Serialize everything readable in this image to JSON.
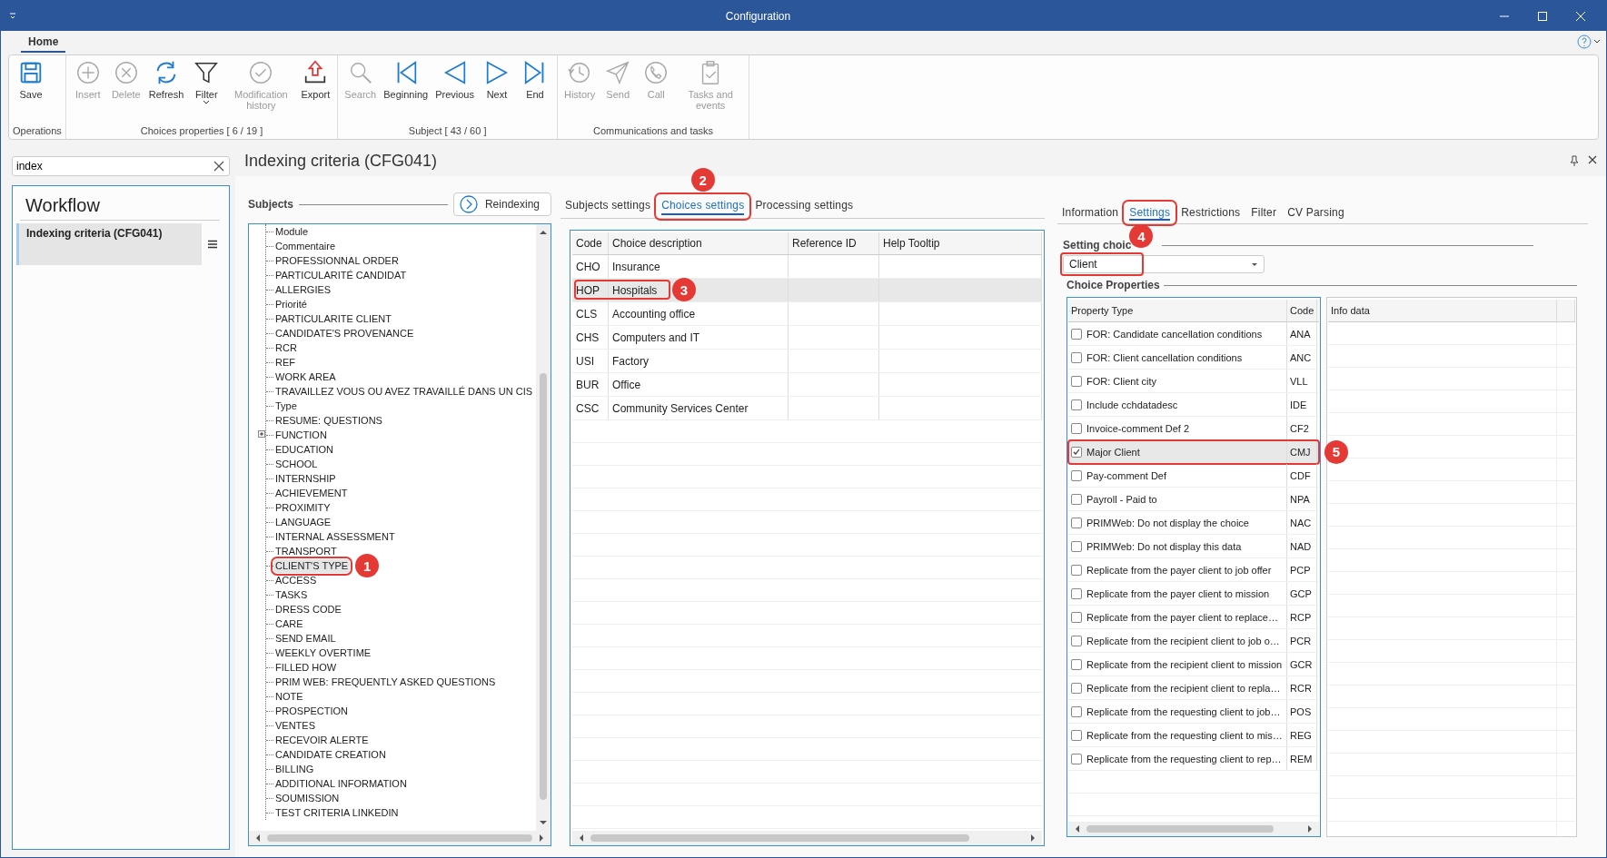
{
  "window": {
    "title": "Configuration"
  },
  "ribbon": {
    "tabs": [
      {
        "label": "Home",
        "selected": true
      }
    ],
    "groups": [
      {
        "label": "Operations",
        "buttons": [
          {
            "label": "Save",
            "disabled": false
          }
        ]
      },
      {
        "label": "Choices properties [ 6 / 19 ]",
        "buttons": [
          {
            "label": "Insert",
            "disabled": true
          },
          {
            "label": "Delete",
            "disabled": true
          },
          {
            "label": "Refresh",
            "disabled": false
          },
          {
            "label": "Filter",
            "disabled": false,
            "dropdown": true
          },
          {
            "label": "Modification history",
            "disabled": true
          },
          {
            "label": "Export",
            "disabled": false
          }
        ]
      },
      {
        "label": "Subject [ 43 / 60 ]",
        "buttons": [
          {
            "label": "Search",
            "disabled": true
          },
          {
            "label": "Beginning",
            "disabled": false
          },
          {
            "label": "Previous",
            "disabled": false
          },
          {
            "label": "Next",
            "disabled": false
          },
          {
            "label": "End",
            "disabled": false
          }
        ]
      },
      {
        "label": "Communications and tasks",
        "buttons": [
          {
            "label": "History",
            "disabled": true
          },
          {
            "label": "Send",
            "disabled": true
          },
          {
            "label": "Call",
            "disabled": true
          },
          {
            "label": "Tasks and events",
            "disabled": true
          }
        ]
      }
    ]
  },
  "search": {
    "value": "index"
  },
  "workflow": {
    "title": "Workflow",
    "items": [
      {
        "label": "Indexing criteria (CFG041)",
        "selected": true
      }
    ]
  },
  "page": {
    "title": "Indexing criteria (CFG041)"
  },
  "subjects": {
    "title": "Subjects",
    "reindex_button": "Reindexing",
    "items": [
      {
        "label": "Module",
        "selected": false
      },
      {
        "label": "Commentaire",
        "selected": false
      },
      {
        "label": "PROFESSIONNAL ORDER",
        "selected": false
      },
      {
        "label": "PARTICULARITÉ CANDIDAT",
        "selected": false
      },
      {
        "label": "ALLERGIES",
        "selected": false
      },
      {
        "label": "Priorité",
        "selected": false
      },
      {
        "label": "PARTICULARITE CLIENT",
        "selected": false
      },
      {
        "label": "CANDIDATE'S PROVENANCE",
        "selected": false
      },
      {
        "label": "RCR",
        "selected": false
      },
      {
        "label": "REF",
        "selected": false
      },
      {
        "label": "WORK AREA",
        "selected": false
      },
      {
        "label": "TRAVAILLEZ VOUS OU AVEZ TRAVAILLÉ DANS UN CIS",
        "selected": false
      },
      {
        "label": "Type",
        "selected": false
      },
      {
        "label": "RESUME: QUESTIONS",
        "selected": false
      },
      {
        "label": "FUNCTION",
        "selected": false,
        "expanded": false
      },
      {
        "label": "EDUCATION",
        "selected": false
      },
      {
        "label": "SCHOOL",
        "selected": false
      },
      {
        "label": "INTERNSHIP",
        "selected": false
      },
      {
        "label": "ACHIEVEMENT",
        "selected": false
      },
      {
        "label": "PROXIMITY",
        "selected": false
      },
      {
        "label": "LANGUAGE",
        "selected": false
      },
      {
        "label": "INTERNAL ASSESSMENT",
        "selected": false
      },
      {
        "label": "TRANSPORT",
        "selected": false
      },
      {
        "label": "CLIENT'S TYPE",
        "selected": true,
        "callout": "1"
      },
      {
        "label": "ACCESS",
        "selected": false
      },
      {
        "label": "TASKS",
        "selected": false
      },
      {
        "label": "DRESS CODE",
        "selected": false
      },
      {
        "label": "CARE",
        "selected": false
      },
      {
        "label": "SEND EMAIL",
        "selected": false
      },
      {
        "label": "WEEKLY OVERTIME",
        "selected": false
      },
      {
        "label": "FILLED HOW",
        "selected": false
      },
      {
        "label": "PRIM WEB: FREQUENTLY ASKED QUESTIONS",
        "selected": false
      },
      {
        "label": "NOTE",
        "selected": false
      },
      {
        "label": "PROSPECTION",
        "selected": false
      },
      {
        "label": "VENTES",
        "selected": false
      },
      {
        "label": "RECEVOIR ALERTE",
        "selected": false
      },
      {
        "label": "CANDIDATE CREATION",
        "selected": false
      },
      {
        "label": "BILLING",
        "selected": false
      },
      {
        "label": "ADDITIONAL INFORMATION",
        "selected": false
      },
      {
        "label": "SOUMISSION",
        "selected": false
      },
      {
        "label": "TEST CRITERIA LINKEDIN",
        "selected": false
      }
    ]
  },
  "main_tabs": [
    {
      "label": "Subjects settings",
      "selected": false
    },
    {
      "label": "Choices settings",
      "selected": true,
      "callout": "2"
    },
    {
      "label": "Processing settings",
      "selected": false
    }
  ],
  "choices_table": {
    "columns": [
      "Code",
      "Choice description",
      "Reference ID",
      "Help Tooltip"
    ],
    "rows": [
      {
        "code": "CHO",
        "description": "Insurance",
        "selected": false
      },
      {
        "code": "HOP",
        "description": "Hospitals",
        "selected": true,
        "callout": "3"
      },
      {
        "code": "CLS",
        "description": "Accounting office",
        "selected": false
      },
      {
        "code": "CHS",
        "description": "Computers and IT",
        "selected": false
      },
      {
        "code": "USI",
        "description": "Factory",
        "selected": false
      },
      {
        "code": "BUR",
        "description": "Office",
        "selected": false
      },
      {
        "code": "CSC",
        "description": "Community Services Center",
        "selected": false
      }
    ]
  },
  "detail_tabs": [
    {
      "label": "Information",
      "selected": false
    },
    {
      "label": "Settings",
      "selected": true,
      "callout": "4"
    },
    {
      "label": "Restrictions",
      "selected": false
    },
    {
      "label": "Filter",
      "selected": false
    },
    {
      "label": "CV Parsing",
      "selected": false
    }
  ],
  "setting_choice": {
    "title": "Setting choic",
    "value": "Client",
    "outlined": true
  },
  "choice_properties": {
    "title": "Choice Properties",
    "columns": [
      "Property Type",
      "Code"
    ],
    "info_columns": [
      "Info data"
    ],
    "rows": [
      {
        "label": "FOR: Candidate cancellation conditions",
        "code": "ANA",
        "checked": false,
        "selected": false
      },
      {
        "label": "FOR: Client cancellation conditions",
        "code": "ANC",
        "checked": false,
        "selected": false
      },
      {
        "label": "FOR: Client city",
        "code": "VLL",
        "checked": false,
        "selected": false
      },
      {
        "label": "Include cchdatadesc",
        "code": "IDE",
        "checked": false,
        "selected": false
      },
      {
        "label": "Invoice-comment Def 2",
        "code": "CF2",
        "checked": false,
        "selected": false
      },
      {
        "label": "Major Client",
        "code": "CMJ",
        "checked": true,
        "selected": true,
        "callout": "5"
      },
      {
        "label": "Pay-comment Def",
        "code": "CDF",
        "checked": false,
        "selected": false
      },
      {
        "label": "Payroll - Paid to",
        "code": "NPA",
        "checked": false,
        "selected": false
      },
      {
        "label": "PRIMWeb: Do not display the choice",
        "code": "NAC",
        "checked": false,
        "selected": false
      },
      {
        "label": "PRIMWeb: Do not display this data",
        "code": "NAD",
        "checked": false,
        "selected": false
      },
      {
        "label": "Replicate from the payer client to job offer",
        "code": "PCP",
        "checked": false,
        "selected": false
      },
      {
        "label": "Replicate from the payer client to mission",
        "code": "GCP",
        "checked": false,
        "selected": false
      },
      {
        "label": "Replicate from the payer client to replace…",
        "code": "RCP",
        "checked": false,
        "selected": false
      },
      {
        "label": "Replicate from the recipient client to job o…",
        "code": "PCR",
        "checked": false,
        "selected": false
      },
      {
        "label": "Replicate from the recipient client to mission",
        "code": "GCR",
        "checked": false,
        "selected": false
      },
      {
        "label": "Replicate from the recipient client to repla…",
        "code": "RCR",
        "checked": false,
        "selected": false
      },
      {
        "label": "Replicate from the requesting client to job…",
        "code": "POS",
        "checked": false,
        "selected": false
      },
      {
        "label": "Replicate from the requesting client to mis…",
        "code": "REG",
        "checked": false,
        "selected": false
      },
      {
        "label": "Replicate from the requesting client to rep…",
        "code": "REM",
        "checked": false,
        "selected": false
      }
    ]
  }
}
